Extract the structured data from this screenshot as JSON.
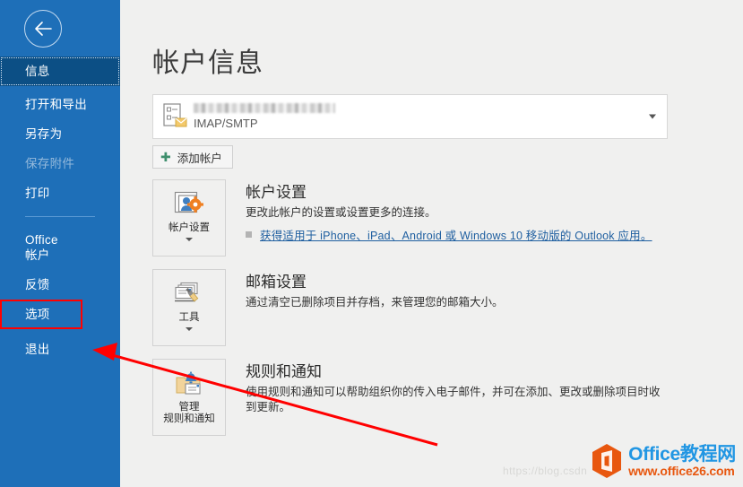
{
  "sidebar": {
    "back_button": "back-arrow",
    "items": [
      {
        "label": "信息",
        "state": "selected"
      },
      {
        "label": "打开和导出",
        "state": "normal"
      },
      {
        "label": "另存为",
        "state": "normal"
      },
      {
        "label": "保存附件",
        "state": "disabled"
      },
      {
        "label": "打印",
        "state": "normal"
      },
      {
        "label": "Office 帐户",
        "state": "normal"
      },
      {
        "label": "反馈",
        "state": "normal"
      },
      {
        "label": "选项",
        "state": "highlighted"
      },
      {
        "label": "退出",
        "state": "normal"
      }
    ]
  },
  "main": {
    "page_title": "帐户信息",
    "account_selector": {
      "email_redacted": "",
      "protocol": "IMAP/SMTP"
    },
    "add_account_button": "添加帐户",
    "sections": [
      {
        "button_label_line1": "帐户设置",
        "button_label_line2": "",
        "title": "帐户设置",
        "description": "更改此帐户的设置或设置更多的连接。",
        "link": "获得适用于 iPhone、iPad、Android 或 Windows 10 移动版的 Outlook 应用。"
      },
      {
        "button_label_line1": "工具",
        "button_label_line2": "",
        "title": "邮箱设置",
        "description": "通过清空已删除项目并存档，来管理您的邮箱大小。",
        "link": ""
      },
      {
        "button_label_line1": "管理",
        "button_label_line2": "规则和通知",
        "title": "规则和通知",
        "description": "使用规则和通知可以帮助组织你的传入电子邮件，并可在添加、更改或删除项目时收到更新。",
        "link": ""
      }
    ]
  },
  "watermarks": {
    "csdn": "https://blog.csdn",
    "office_site_name": "Office教程网",
    "office_site_url": "www.office26.com"
  },
  "colors": {
    "sidebar_blue": "#1e6fb8",
    "sidebar_selected": "#0c4f85",
    "content_bg": "#f0f0ef",
    "highlight_red": "#ff0000",
    "link_blue": "#1f5fa0",
    "accent_green": "#3f8f6d"
  }
}
